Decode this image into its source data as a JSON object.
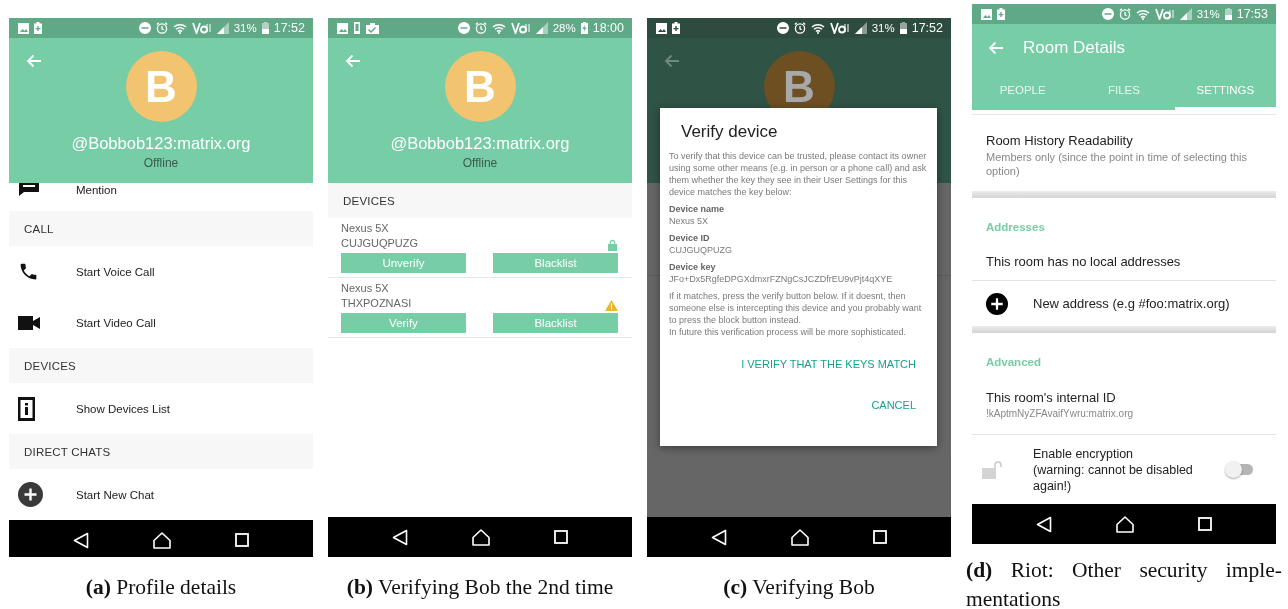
{
  "panels": [
    {
      "kind": "profile",
      "status_bar": {
        "battery": "31%",
        "charging": false,
        "time": "17:52"
      },
      "profile": {
        "initial": "B",
        "user_id": "@Bobbob123:matrix.org",
        "presence": "Offline"
      },
      "items": [
        {
          "kind": "mention",
          "label": "Mention"
        },
        {
          "kind": "section",
          "label": "CALL"
        },
        {
          "kind": "voice-call",
          "label": "Start Voice Call"
        },
        {
          "kind": "video-call",
          "label": "Start Video Call"
        },
        {
          "kind": "section",
          "label": "DEVICES"
        },
        {
          "kind": "device-list",
          "label": "Show Devices List"
        },
        {
          "kind": "section",
          "label": "DIRECT CHATS"
        },
        {
          "kind": "new-chat",
          "label": "Start New Chat"
        }
      ],
      "caption": "**(a)** Profile details"
    },
    {
      "kind": "devices",
      "status_bar": {
        "battery": "28%",
        "charging": true,
        "time": "18:00"
      },
      "profile": {
        "initial": "B",
        "user_id": "@Bobbob123:matrix.org",
        "presence": "Offline"
      },
      "section": "DEVICES",
      "devices": [
        {
          "name": "Nexus 5X",
          "id": "CUJGUQPUZG",
          "verified": true,
          "buttons": [
            "Unverify",
            "Blacklist"
          ]
        },
        {
          "name": "Nexus 5X",
          "id": "THXPOZNASI",
          "verified": false,
          "buttons": [
            "Verify",
            "Blacklist"
          ]
        }
      ],
      "caption": "**(b)** Verifying Bob the 2nd time"
    },
    {
      "kind": "dialog",
      "status_bar": {
        "battery": "31%",
        "charging": false,
        "time": "17:52"
      },
      "profile": {
        "initial": "B"
      },
      "dialog": {
        "title": "Verify device",
        "intro": "To verify that this device can be trusted, please contact its owner using some other means (e.g. in person or a phone call) and ask them whether the key they see in their User Settings for this device matches the key below:",
        "fields": [
          {
            "label": "Device name",
            "value": "Nexus 5X"
          },
          {
            "label": "Device ID",
            "value": "CUJGUQPUZG"
          },
          {
            "label": "Device key",
            "value": "JFo+Dx5RgfeDPGXdmxrFZNgCsJCZDfrEU9vPjt4qXYE"
          }
        ],
        "notes": [
          "If it matches, press the verify button below. If it doesnt, then someone else is intercepting this device and you probably want to press the block button instead.",
          "In future this verification process will be more sophisticated."
        ],
        "buttons": [
          "I VERIFY THAT THE KEYS MATCH",
          "CANCEL"
        ]
      },
      "caption": "**(c)** Verifying Bob"
    },
    {
      "kind": "room",
      "status_bar": {
        "battery": "31%",
        "charging": false,
        "time": "17:53"
      },
      "title": "Room Details",
      "tabs": [
        {
          "label": "PEOPLE",
          "selected": false
        },
        {
          "label": "FILES",
          "selected": false
        },
        {
          "label": "SETTINGS",
          "selected": true
        }
      ],
      "items": [
        {
          "kind": "setting",
          "title": "Room History Readability",
          "value": "Members only (since the point in time of selecting this option)"
        },
        {
          "kind": "separator"
        },
        {
          "kind": "section",
          "label": "Addresses"
        },
        {
          "kind": "text",
          "label": "This room has no local addresses"
        },
        {
          "kind": "add",
          "label": "New address (e.g #foo:matrix.org)"
        },
        {
          "kind": "separator"
        },
        {
          "kind": "section",
          "label": "Advanced"
        },
        {
          "kind": "setting",
          "title": "This room's internal ID",
          "value": "!kAptmNyZFAvaifYwru:matrix.org"
        },
        {
          "kind": "toggle",
          "label": "Enable encryption",
          "note": "(warning: cannot be disabled again!)",
          "on": false
        }
      ],
      "caption": "**(d)** Riot: Other security imple-mentations"
    }
  ]
}
